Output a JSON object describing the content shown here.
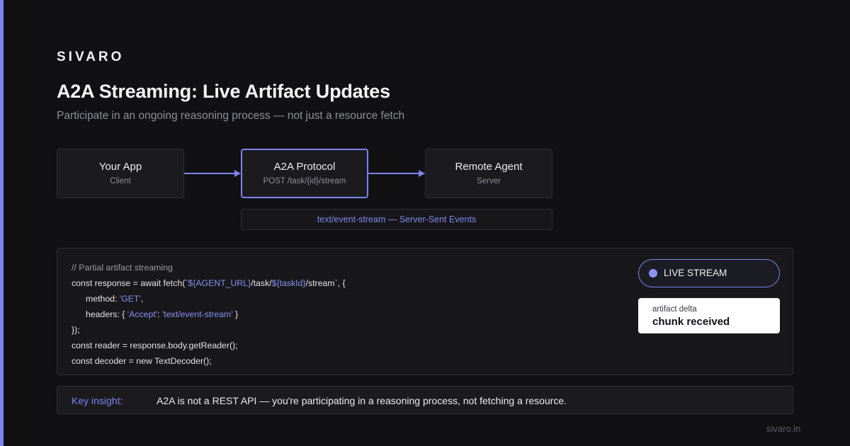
{
  "brand": "SIVARO",
  "title": "A2A Streaming: Live Artifact Updates",
  "subtitle": "Participate in an ongoing reasoning process — not just a resource fetch",
  "colors": {
    "accent": "#7b84f0",
    "background": "#111113",
    "panel": "#18181b"
  },
  "diagram": {
    "nodes": [
      {
        "title": "Your App",
        "sub": "Client"
      },
      {
        "title": "A2A Protocol",
        "sub": "POST /task/{id}/stream"
      },
      {
        "title": "Remote Agent",
        "sub": "Server"
      }
    ],
    "channel": "text/event-stream — Server-Sent Events"
  },
  "code": {
    "comment": "// Partial artifact streaming",
    "line2_a": "const response = await fetch(`",
    "line2_b": "${AGENT_URL}",
    "line2_c": "/task/",
    "line2_d": "${taskId}",
    "line2_e": "/stream`, {",
    "line3_a": "method: ",
    "line3_b": "'GET'",
    "line3_c": ",",
    "line4_a": "headers: { ",
    "line4_b": "'Accept'",
    "line4_c": ": ",
    "line4_d": "'text/event-stream'",
    "line4_e": " }",
    "line5": "});",
    "line6": "const reader = response.body.getReader();",
    "line7": "const decoder = new TextDecoder();"
  },
  "live": {
    "pill_label": "LIVE STREAM",
    "card_label": "artifact delta",
    "card_value": "chunk received"
  },
  "insight": {
    "key": "Key insight:",
    "text": "A2A is not a REST API — you're participating in a reasoning process, not fetching a resource."
  },
  "footer": "sivaro.in"
}
